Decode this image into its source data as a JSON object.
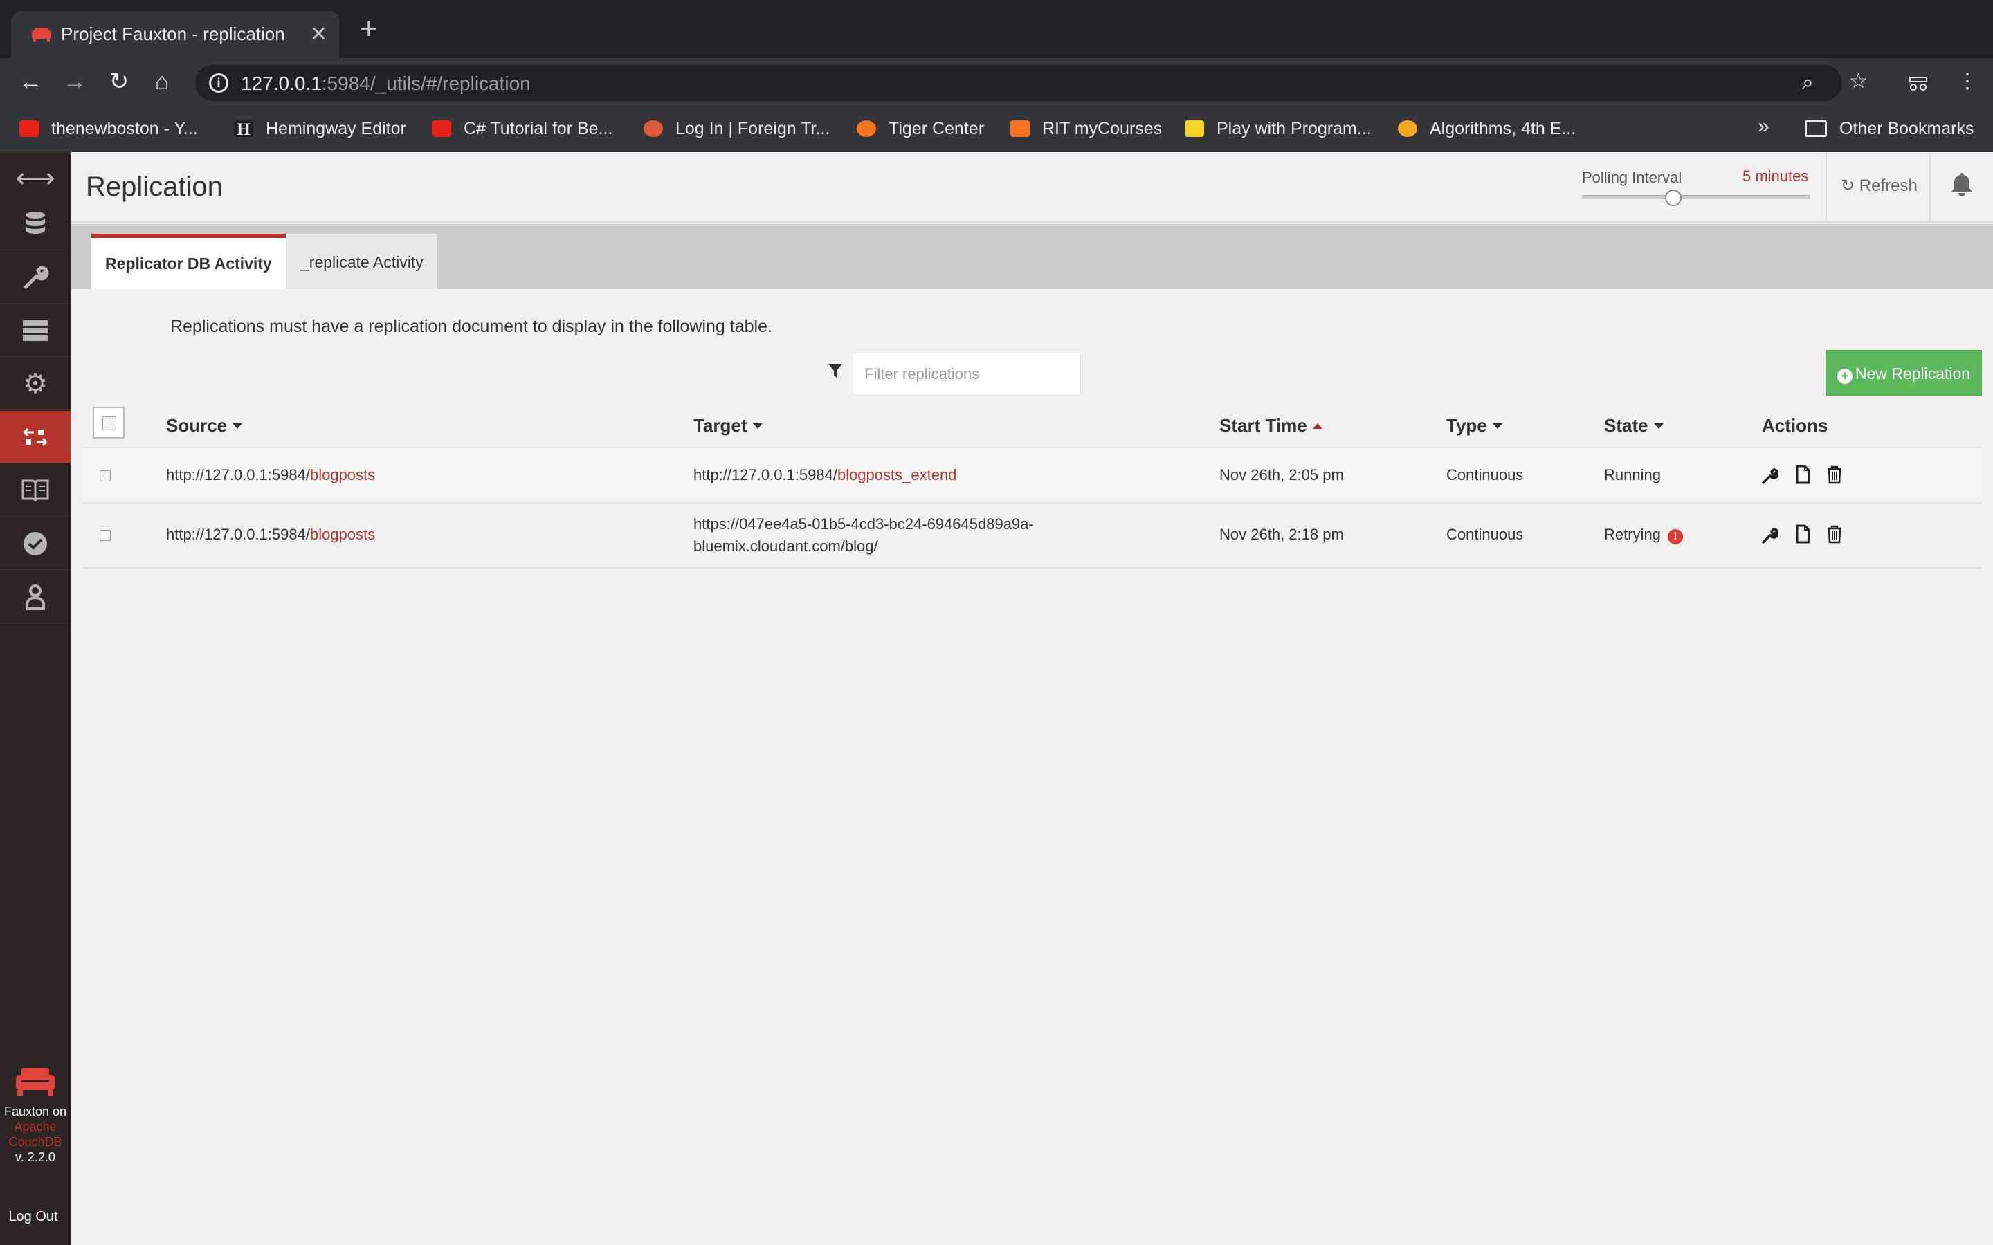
{
  "browser": {
    "tab_title": "Project Fauxton - replication",
    "url_host": "127.0.0.1",
    "url_rest": ":5984/_utils/#/replication",
    "bookmarks": [
      {
        "label": "thenewboston - Y...",
        "color": "#e62117"
      },
      {
        "label": "Hemingway Editor",
        "color": "#202124"
      },
      {
        "label": "C# Tutorial for Be...",
        "color": "#e62117"
      },
      {
        "label": "Log In | Foreign Tr...",
        "color": "#e05a3a"
      },
      {
        "label": "Tiger Center",
        "color": "#f47321"
      },
      {
        "label": "RIT myCourses",
        "color": "#f47321"
      },
      {
        "label": "Play with Program...",
        "color": "#f5d328"
      },
      {
        "label": "Algorithms, 4th E...",
        "color": "#f5a623"
      }
    ],
    "other_bookmarks": "Other Bookmarks"
  },
  "sidebar": {
    "items": [
      "expand-icon",
      "database-icon",
      "wrench-icon",
      "server-icon",
      "gear-icon",
      "replication-icon",
      "docs-icon",
      "verify-icon",
      "user-icon"
    ],
    "footer_line1": "Fauxton on",
    "footer_line2": "Apache",
    "footer_line3": "CouchDB",
    "footer_version": "v. 2.2.0",
    "logout": "Log Out"
  },
  "header": {
    "title": "Replication",
    "polling_label": "Polling Interval",
    "polling_value": "5 minutes",
    "polling_level": 0.4,
    "refresh": "Refresh"
  },
  "tabs": [
    {
      "label": "Replicator DB Activity",
      "active": true
    },
    {
      "label": "_replicate Activity",
      "active": false
    }
  ],
  "content": {
    "intro": "Replications must have a replication document to display in the following table.",
    "filter_placeholder": "Filter replications",
    "new_replication": "New Replication",
    "columns": {
      "source": "Source",
      "target": "Target",
      "start_time": "Start Time",
      "type": "Type",
      "state": "State",
      "actions": "Actions"
    },
    "rows": [
      {
        "source_base": "http://127.0.0.1:5984/",
        "source_db": "blogposts",
        "target_base": "http://127.0.0.1:5984/",
        "target_db": "blogposts_extend",
        "start_time": "Nov 26th, 2:05 pm",
        "type": "Continuous",
        "state": "Running"
      },
      {
        "source_base": "http://127.0.0.1:5984/",
        "source_db": "blogposts",
        "target_line1": "https://047ee4a5-01b5-4cd3-bc24-694645d89a9a-",
        "target_line2": "bluemix.cloudant.com/blog/",
        "start_time": "Nov 26th, 2:18 pm",
        "type": "Continuous",
        "state": "Retrying"
      }
    ]
  },
  "colors": {
    "accent": "#b5342b",
    "sidebar_bg": "#2d2523",
    "success": "#5cb85c"
  }
}
